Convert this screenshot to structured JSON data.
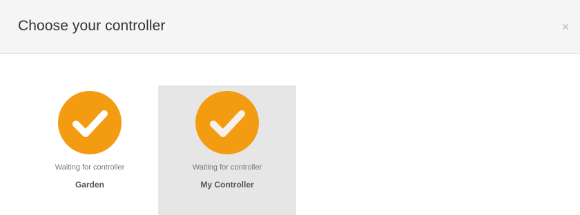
{
  "modal": {
    "title": "Choose your controller",
    "close_label": "×"
  },
  "controllers": [
    {
      "status": "Waiting for controller",
      "name": "Garden",
      "selected": false,
      "icon": "checkmark-icon"
    },
    {
      "status": "Waiting for controller",
      "name": "My Controller",
      "selected": true,
      "icon": "checkmark-icon"
    }
  ],
  "colors": {
    "accent": "#f39c12",
    "header_bg": "#f5f5f5",
    "selected_bg": "#e6e6e6"
  }
}
